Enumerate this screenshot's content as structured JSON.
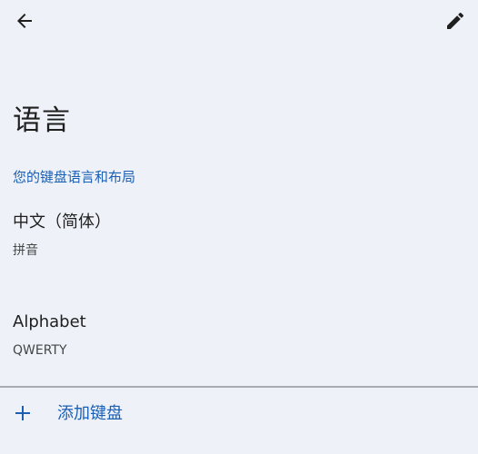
{
  "toolbar": {
    "back_icon": "arrow-back-icon",
    "edit_icon": "pencil-icon"
  },
  "page": {
    "title": "语言"
  },
  "section": {
    "header": "您的键盘语言和布局"
  },
  "languages": [
    {
      "name": "中文（简体）",
      "layout": "拼音"
    },
    {
      "name": "Alphabet",
      "layout": "QWERTY"
    }
  ],
  "add_keyboard": {
    "icon": "plus-icon",
    "label": "添加键盘"
  },
  "colors": {
    "background": "#eef2f8",
    "accent": "#1a5fb4",
    "text_primary": "#1f1f1f",
    "text_secondary": "#444746",
    "divider": "#a9adb3"
  }
}
